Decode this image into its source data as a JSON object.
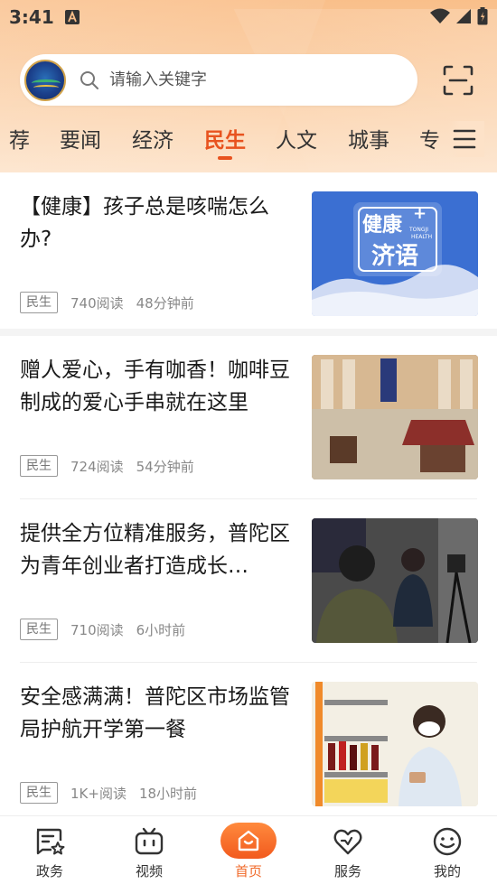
{
  "status_bar": {
    "time": "3:41"
  },
  "search": {
    "placeholder": "请输入关键字"
  },
  "tabs": [
    {
      "label": "荐",
      "active": false
    },
    {
      "label": "要闻",
      "active": false
    },
    {
      "label": "经济",
      "active": false
    },
    {
      "label": "民生",
      "active": true
    },
    {
      "label": "人文",
      "active": false
    },
    {
      "label": "城事",
      "active": false
    },
    {
      "label": "专",
      "active": false
    }
  ],
  "articles": [
    {
      "title": "【健康】孩子总是咳喘怎么办?",
      "tag": "民生",
      "reads": "740阅读",
      "time": "48分钟前",
      "thumb_text": {
        "line1": "健康",
        "line2": "济语",
        "small1": "TONGJI",
        "small2": "HEALTH"
      }
    },
    {
      "title": "赠人爱心，手有咖香！咖啡豆制成的爱心手串就在这里",
      "tag": "民生",
      "reads": "724阅读",
      "time": "54分钟前"
    },
    {
      "title": "提供全方位精准服务，普陀区为青年创业者打造成长…",
      "tag": "民生",
      "reads": "710阅读",
      "time": "6小时前"
    },
    {
      "title": "安全感满满！普陀区市场监管局护航开学第一餐",
      "tag": "民生",
      "reads": "1K+阅读",
      "time": "18小时前"
    }
  ],
  "bottom_nav": [
    {
      "label": "政务",
      "icon": "gov-affairs-icon"
    },
    {
      "label": "视频",
      "icon": "video-tv-icon"
    },
    {
      "label": "首页",
      "icon": "home-icon",
      "active": true
    },
    {
      "label": "服务",
      "icon": "heart-service-icon"
    },
    {
      "label": "我的",
      "icon": "smiley-profile-icon"
    }
  ],
  "colors": {
    "accent": "#e8531f",
    "header_bg": "#f9bf8a",
    "nav_active": "#f06a2a"
  }
}
